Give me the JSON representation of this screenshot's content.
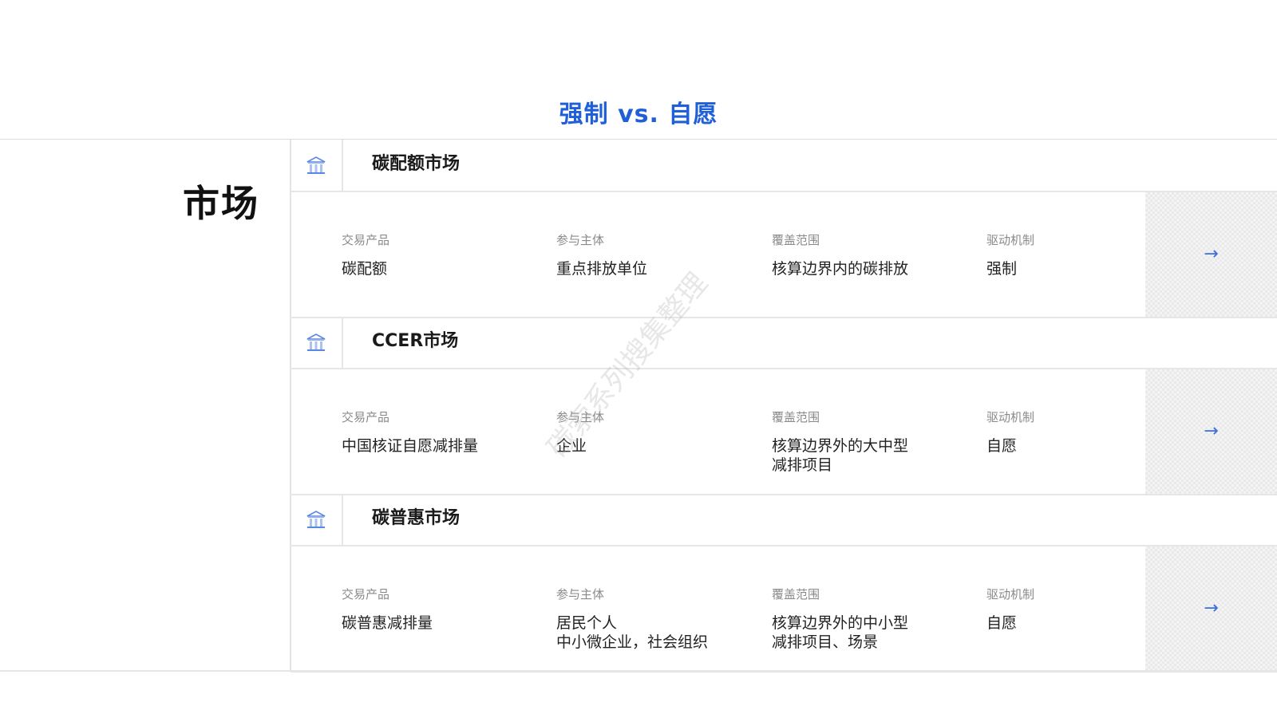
{
  "title": "强制 vs. 自愿",
  "left_label": "市场",
  "watermark": "碳索系列搜集整理",
  "accent_color": "#1f5fd8",
  "markets": [
    {
      "name": "碳配额市场",
      "icon": "building-icon",
      "fields": [
        {
          "label": "交易产品",
          "value": "碳配额"
        },
        {
          "label": "参与主体",
          "value": "重点排放单位"
        },
        {
          "label": "覆盖范围",
          "value": "核算边界内的碳排放"
        },
        {
          "label": "驱动机制",
          "value": "强制"
        }
      ],
      "arrow": "→"
    },
    {
      "name": "CCER市场",
      "icon": "building-icon",
      "fields": [
        {
          "label": "交易产品",
          "value": "中国核证自愿减排量"
        },
        {
          "label": "参与主体",
          "value": "企业"
        },
        {
          "label": "覆盖范围",
          "value": "核算边界外的大中型\n减排项目"
        },
        {
          "label": "驱动机制",
          "value": "自愿"
        }
      ],
      "arrow": "→"
    },
    {
      "name": "碳普惠市场",
      "icon": "building-icon",
      "fields": [
        {
          "label": "交易产品",
          "value": "碳普惠减排量"
        },
        {
          "label": "参与主体",
          "value": "居民个人\n中小微企业，社会组织"
        },
        {
          "label": "覆盖范围",
          "value": "核算边界外的中小型\n减排项目、场景"
        },
        {
          "label": "驱动机制",
          "value": "自愿"
        }
      ],
      "arrow": "→"
    }
  ]
}
